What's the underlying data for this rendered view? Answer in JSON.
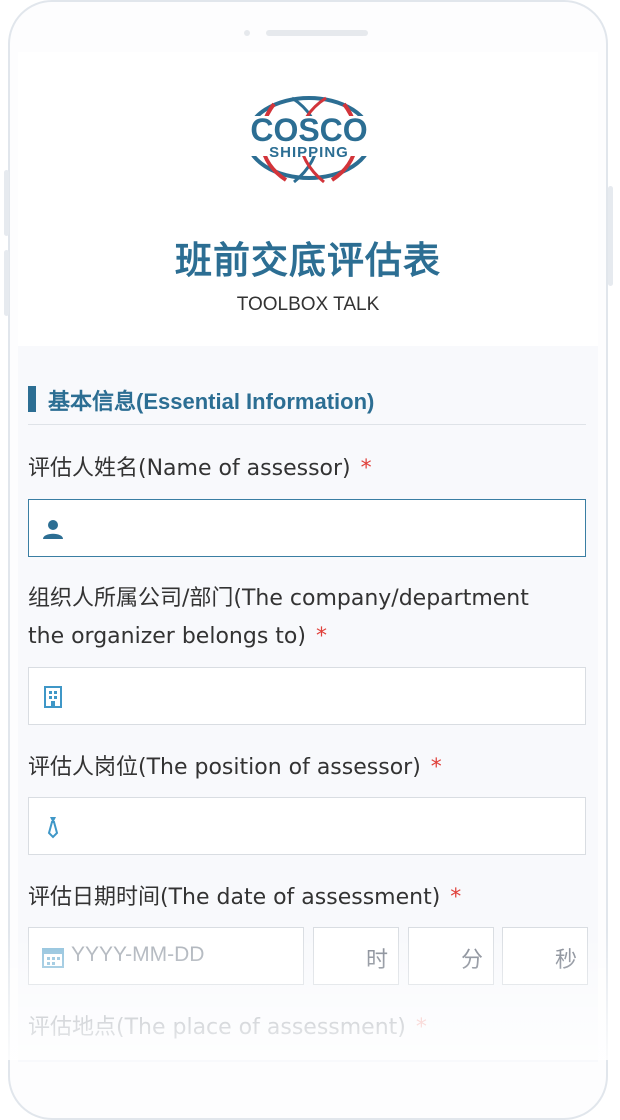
{
  "header": {
    "logo_line1": "COSCO",
    "logo_line2": "SHIPPING",
    "title": "班前交底评估表",
    "subtitle": "TOOLBOX TALK"
  },
  "section": {
    "title": "基本信息(Essential Information)"
  },
  "fields": [
    {
      "label": "评估人姓名(Name of assessor)",
      "required": "*",
      "icon": "user-icon",
      "value": ""
    },
    {
      "label_line1": "组织人所属公司/部门(The company/department",
      "label_line2": "the organizer belongs to)",
      "required": "*",
      "icon": "building-icon",
      "value": ""
    },
    {
      "label": "评估人岗位(The position of assessor)",
      "required": "*",
      "icon": "tie-icon",
      "value": ""
    },
    {
      "label": "评估日期时间(The date of assessment)",
      "required": "*",
      "icon": "calendar-icon"
    },
    {
      "label": "评估地点(The place of assessment)",
      "required": "*"
    }
  ],
  "date_time": {
    "date_placeholder": "YYYY-MM-DD",
    "hour_unit": "时",
    "minute_unit": "分",
    "second_unit": "秒"
  },
  "colors": {
    "brand": "#2c6e93",
    "required": "#e0403a",
    "logo_red": "#d2343a"
  }
}
